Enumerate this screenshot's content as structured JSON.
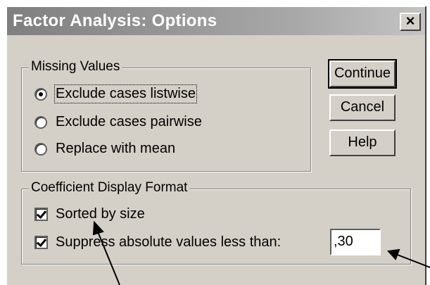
{
  "window": {
    "title": "Factor Analysis: Options",
    "close_glyph": "×"
  },
  "missing_values": {
    "legend": "Missing Values",
    "options": [
      {
        "label": "Exclude cases listwise",
        "checked": true
      },
      {
        "label": "Exclude cases pairwise",
        "checked": false
      },
      {
        "label": "Replace with mean",
        "checked": false
      }
    ]
  },
  "coefficient_format": {
    "legend": "Coefficient Display Format",
    "sorted": {
      "label": "Sorted by size",
      "checked": true
    },
    "suppress": {
      "label": "Suppress absolute values less than:",
      "checked": true,
      "value": ",30"
    }
  },
  "buttons": {
    "continue": "Continue",
    "cancel": "Cancel",
    "help": "Help"
  }
}
